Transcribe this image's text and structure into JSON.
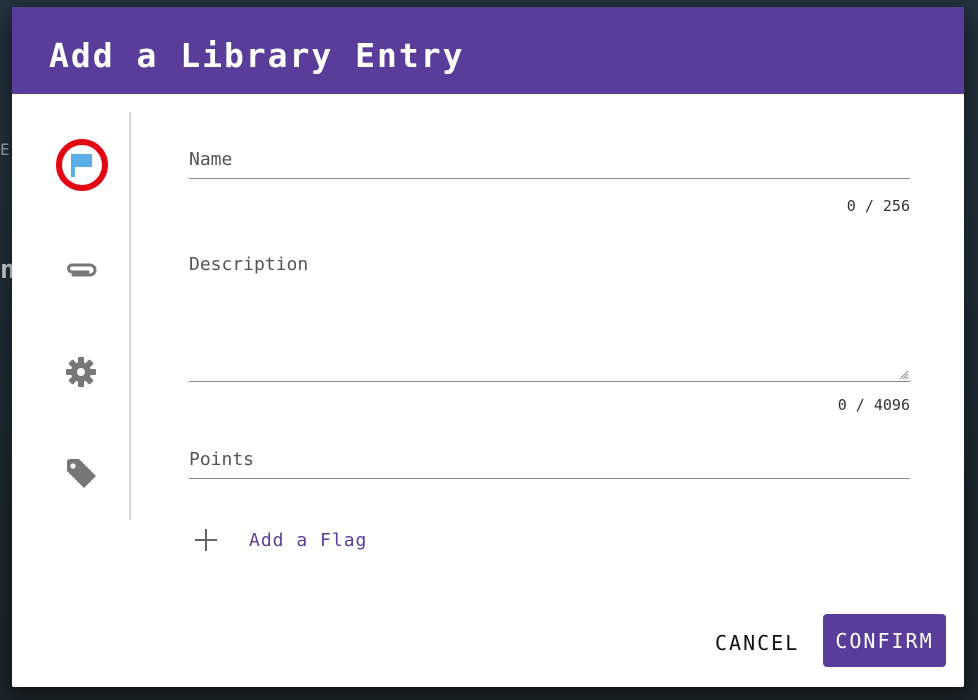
{
  "dialog": {
    "title": "Add a Library Entry"
  },
  "rail": {
    "items": [
      {
        "icon": "flag-icon",
        "active": true
      },
      {
        "icon": "paperclip-icon",
        "active": false
      },
      {
        "icon": "gear-icon",
        "active": false
      },
      {
        "icon": "tag-icon",
        "active": false
      }
    ],
    "active_color": "#e30613",
    "flag_color": "#5aaee6",
    "icon_color": "#777777"
  },
  "form": {
    "name": {
      "placeholder": "Name",
      "value": "",
      "counter": "0 / 256"
    },
    "description": {
      "placeholder": "Description",
      "value": "",
      "counter": "0 / 4096"
    },
    "points": {
      "placeholder": "Points",
      "value": ""
    },
    "add_flag_label": "Add a Flag"
  },
  "actions": {
    "cancel_label": "CANCEL",
    "confirm_label": "CONFIRM"
  },
  "theme": {
    "header_color": "#5a3d9a",
    "accent_color": "#5a3d9a"
  },
  "background": {
    "partial_text_1": "E",
    "partial_text_2": "n"
  }
}
